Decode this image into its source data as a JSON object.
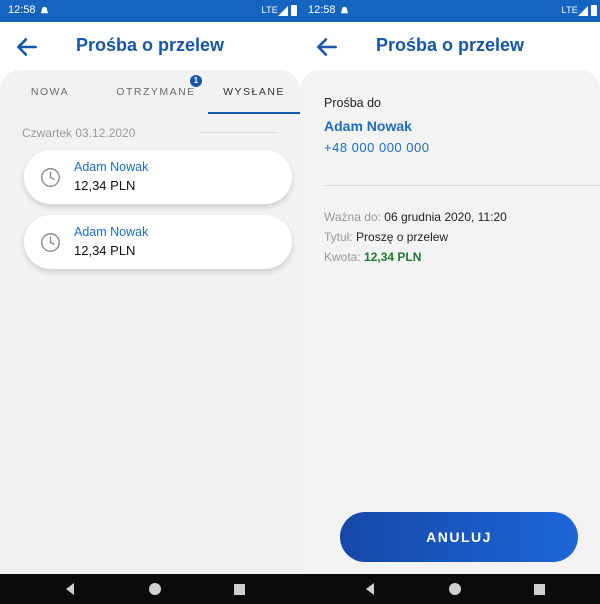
{
  "status_bar": {
    "time": "12:58",
    "network": "LTE"
  },
  "left_screen": {
    "title": "Prośba o przelew",
    "tabs": [
      {
        "label": "NOWA",
        "active": false
      },
      {
        "label": "OTRZYMANE",
        "active": false,
        "badge": "1"
      },
      {
        "label": "WYSŁANE",
        "active": true
      }
    ],
    "date_group": "Czwartek 03.12.2020",
    "requests": [
      {
        "name": "Adam Nowak",
        "amount": "12,34 PLN"
      },
      {
        "name": "Adam Nowak",
        "amount": "12,34 PLN"
      }
    ]
  },
  "right_screen": {
    "title": "Prośba o przelew",
    "recipient_label": "Prośba do",
    "recipient_name": "Adam Nowak",
    "recipient_phone": "+48 000 000 000",
    "valid_until_label": "Ważna do:",
    "valid_until_value": "06 grudnia 2020, 11:20",
    "subject_label": "Tytuł:",
    "subject_value": "Proszę o przelew",
    "amount_label": "Kwota:",
    "amount_value": "12,34 PLN",
    "cancel_button": "ANULUJ"
  },
  "colors": {
    "brand_blue": "#1756a9",
    "status_bar": "#1565c0",
    "link_blue": "#1f6bc4",
    "amount_green": "#1e7a2e"
  }
}
